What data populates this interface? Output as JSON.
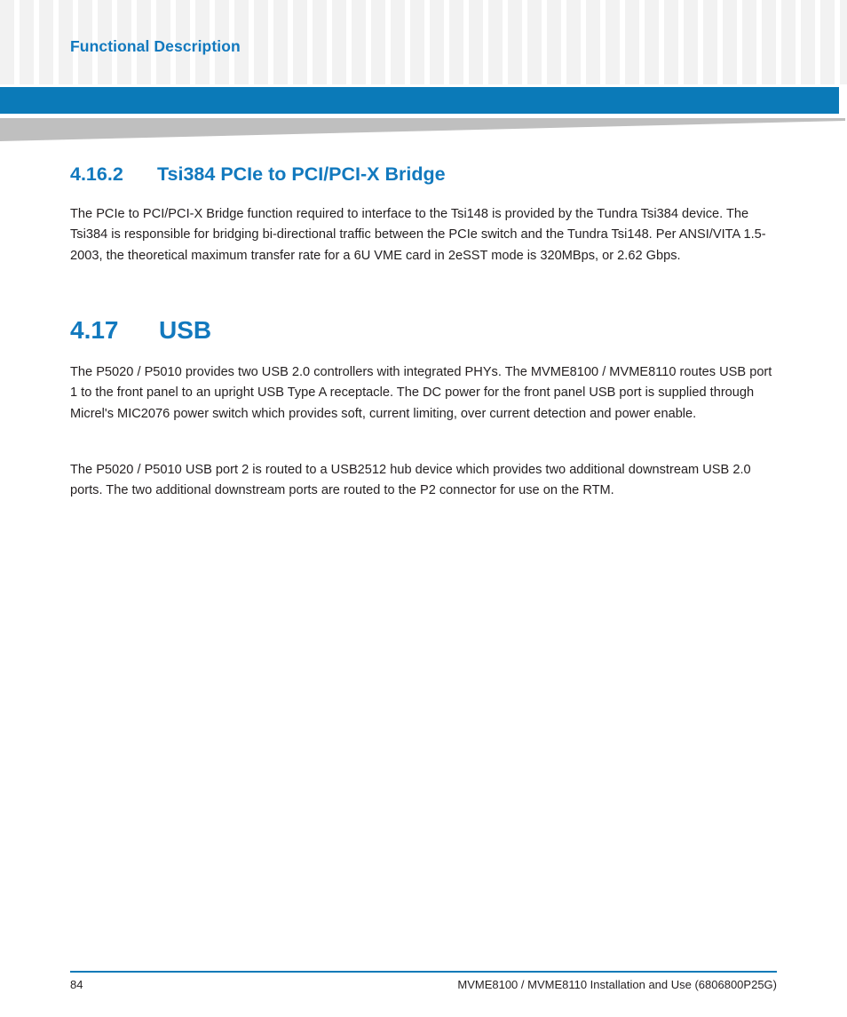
{
  "page": {
    "running_head": "Functional Description",
    "accent_color": "#0b7ab8",
    "heading_color": "#1279be",
    "body_color": "#231f20",
    "pattern_color": "#f2f2f2",
    "wedge_color": "#bfbfbf"
  },
  "sections": [
    {
      "number": "4.16.2",
      "title": "Tsi384 PCIe to PCI/PCI-X Bridge",
      "level": 3
    },
    {
      "number": "4.17",
      "title": "USB",
      "level": 2
    }
  ],
  "paragraphs": [
    {
      "id": "tsi384-body",
      "text": "The PCIe to PCI/PCI-X Bridge function required to interface to the Tsi148 is provided by the Tundra Tsi384 device. The Tsi384 is responsible for bridging bi-directional traffic between the PCIe switch and the Tundra Tsi148. Per ANSI/VITA 1.5-2003, the theoretical maximum transfer rate for a 6U VME card in 2eSST mode is 320MBps, or 2.62 Gbps."
    },
    {
      "id": "usb-body-1",
      "text": "The P5020 / P5010 provides two USB 2.0 controllers with integrated PHYs. The MVME8100 / MVME8110 routes USB port 1 to the front panel to an upright USB Type A receptacle. The DC power for the front panel USB port is supplied through Micrel's MIC2076 power switch which provides soft, current limiting, over current detection and power enable."
    },
    {
      "id": "usb-body-2",
      "text": "The P5020 / P5010 USB port 2 is routed to a USB2512 hub device which provides two additional downstream USB 2.0 ports. The two additional downstream ports are routed to the P2 connector for use on the RTM."
    }
  ],
  "footer": {
    "page_number": "84",
    "document_title": "MVME8100 / MVME8110 Installation and Use (6806800P25G)"
  }
}
